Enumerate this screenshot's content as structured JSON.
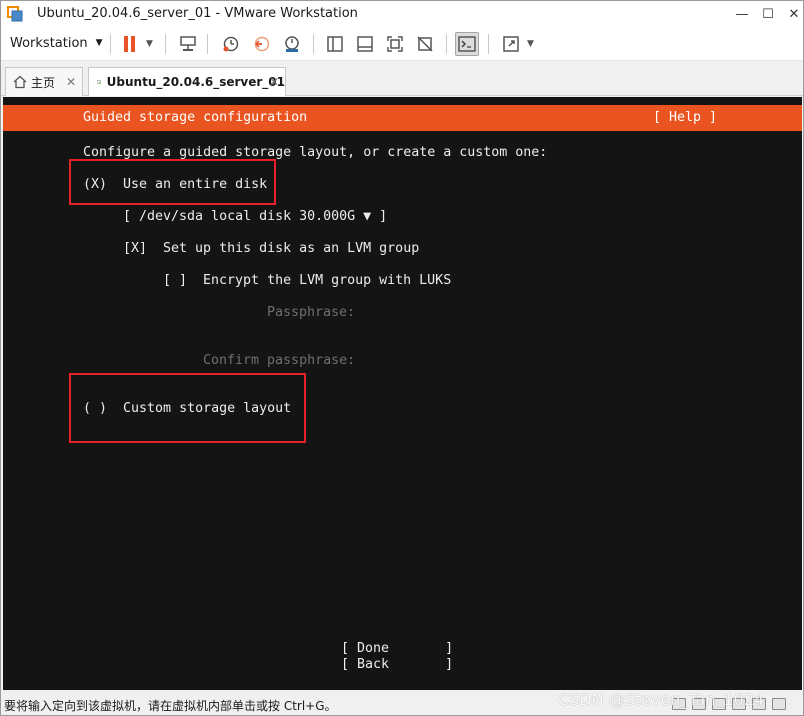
{
  "window": {
    "title": "Ubuntu_20.04.6_server_01 - VMware Workstation",
    "minimize": "—",
    "maximize": "☐",
    "close": "✕"
  },
  "toolbar": {
    "workstation_menu": "Workstation"
  },
  "tabs": [
    {
      "label": "主页"
    },
    {
      "label": "Ubuntu_20.04.6_server_01"
    }
  ],
  "installer": {
    "header_title": "Guided storage configuration",
    "header_help": "[ Help ]",
    "intro": "Configure a guided storage layout, or create a custom one:",
    "option_entire_disk": "(X)  Use an entire disk",
    "disk_select": "[ /dev/sda local disk 30.000G ▼ ]",
    "lvm_checkbox": "[X]  Set up this disk as an LVM group",
    "encrypt_checkbox": "[ ]  Encrypt the LVM group with LUKS",
    "passphrase_label": "Passphrase:",
    "confirm_passphrase_label": "Confirm passphrase:",
    "option_custom": "( )  Custom storage layout",
    "done_button": "[ Done       ]",
    "back_button": "[ Back       ]"
  },
  "statusbar": {
    "message": "要将输入定向到该虚拟机，请在虚拟机内部单击或按 Ctrl+G。",
    "watermark": "CSDN @Steven_Tan_1024"
  },
  "colors": {
    "ubuntu_orange": "#e95420",
    "console_bg": "#141414",
    "highlight_box": "#e8202a"
  }
}
